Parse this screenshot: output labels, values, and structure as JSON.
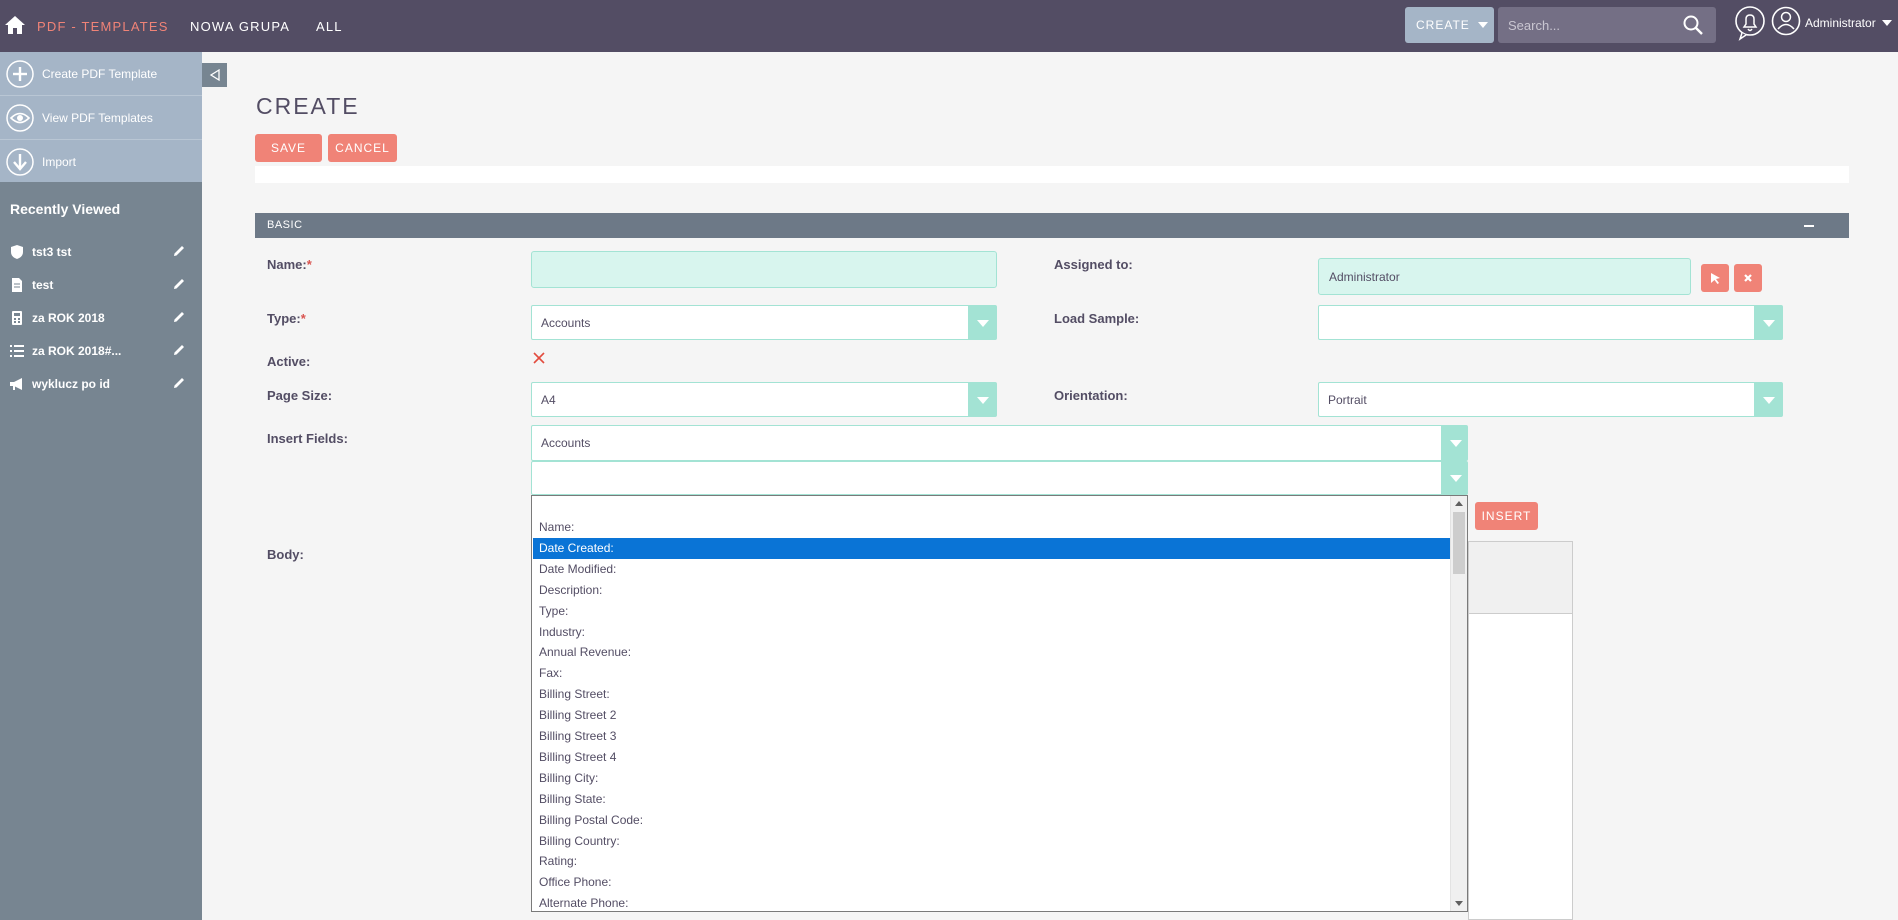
{
  "nav": {
    "module": "PDF - TEMPLATES",
    "group": "NOWA GRUPA",
    "all": "ALL",
    "create": "CREATE",
    "search_placeholder": "Search...",
    "user": "Administrator"
  },
  "sidebar": {
    "actions": [
      "Create PDF Template",
      "View PDF Templates",
      "Import"
    ],
    "recent_title": "Recently Viewed",
    "recent": [
      {
        "label": "tst3 tst",
        "icon": "shield-icon"
      },
      {
        "label": "test",
        "icon": "document-icon"
      },
      {
        "label": "za ROK 2018",
        "icon": "calculator-icon"
      },
      {
        "label": "za ROK 2018#...",
        "icon": "list-icon"
      },
      {
        "label": "wyklucz po id",
        "icon": "megaphone-icon"
      }
    ]
  },
  "page": {
    "title": "CREATE",
    "save": "SAVE",
    "cancel": "CANCEL",
    "panel": "BASIC"
  },
  "form": {
    "name_label": "Name:",
    "name_value": "",
    "required": "*",
    "assigned_label": "Assigned to:",
    "assigned_value": "Administrator",
    "type_label": "Type:",
    "type_value": "Accounts",
    "load_sample_label": "Load Sample:",
    "load_sample_value": "",
    "active_label": "Active:",
    "page_size_label": "Page Size:",
    "page_size_value": "A4",
    "orientation_label": "Orientation:",
    "orientation_value": "Portrait",
    "insert_fields_label": "Insert Fields:",
    "insert_module_value": "Accounts",
    "insert_field_value": "",
    "insert_button": "INSERT",
    "body_label": "Body:"
  },
  "dropdown": {
    "selected_index": 1,
    "options": [
      "Name:",
      "Date Created:",
      "Date Modified:",
      "Description:",
      "Type:",
      "Industry:",
      "Annual Revenue:",
      "Fax:",
      "Billing Street:",
      "Billing Street 2",
      "Billing Street 3",
      "Billing Street 4",
      "Billing City:",
      "Billing State:",
      "Billing Postal Code:",
      "Billing Country:",
      "Rating:",
      "Office Phone:",
      "Alternate Phone:"
    ]
  },
  "colors": {
    "nav_bg": "#534d64",
    "accent": "#f08377",
    "field_bg": "#d8f5ee",
    "selection": "#0a74d6"
  }
}
